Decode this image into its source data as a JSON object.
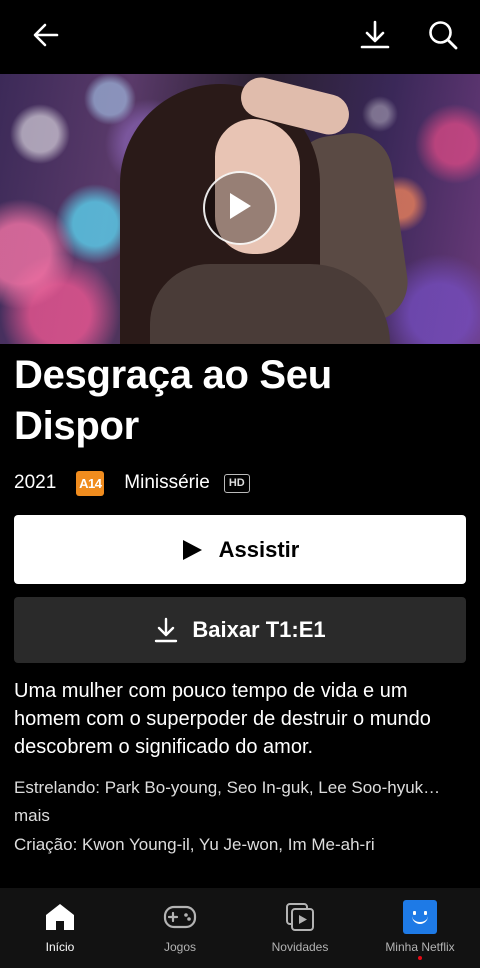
{
  "title": "Desgraça ao Seu Dispor",
  "meta": {
    "year": "2021",
    "rating": "A14",
    "type": "Minissérie",
    "quality": "HD"
  },
  "actions": {
    "play_label": "Assistir",
    "download_label": "Baixar T1:E1"
  },
  "description": "Uma mulher com pouco tempo de vida e um homem com o superpoder de destruir o mundo descobrem o significado do amor.",
  "cast": "Estrelando: Park Bo-young, Seo In-guk, Lee Soo-hyuk… mais",
  "creators": "Criação: Kwon Young-il, Yu Je-won, Im Me-ah-ri",
  "nav": {
    "items": [
      {
        "label": "Início",
        "icon": "home-icon",
        "active": true
      },
      {
        "label": "Jogos",
        "icon": "gamepad-icon",
        "active": false
      },
      {
        "label": "Novidades",
        "icon": "new-hot-icon",
        "active": false
      },
      {
        "label": "Minha Netflix",
        "icon": "profile-avatar-icon",
        "active": false
      }
    ]
  },
  "colors": {
    "background": "#000000",
    "rating_badge": "#f08c1e",
    "play_button": "#ffffff",
    "download_button": "#2a2a2a",
    "avatar": "#1e7ae6",
    "notification_dot": "#e50914"
  }
}
